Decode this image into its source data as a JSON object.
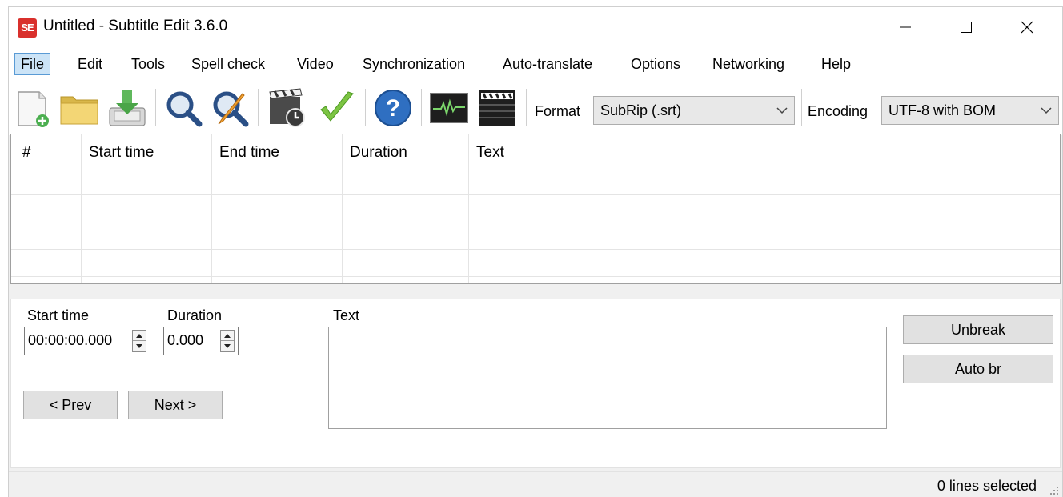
{
  "window": {
    "app_icon_text": "SE",
    "title": "Untitled - Subtitle Edit 3.6.0"
  },
  "menu": {
    "items": [
      {
        "label": "File",
        "mnemonic": "F",
        "rest": "ile",
        "active": true
      },
      {
        "label": "Edit"
      },
      {
        "label": "Tools"
      },
      {
        "label": "Spell check"
      },
      {
        "label": "Video"
      },
      {
        "label": "Synchronization"
      },
      {
        "label": "Auto-translate"
      },
      {
        "label": "Options"
      },
      {
        "label": "Networking"
      },
      {
        "label": "Help"
      }
    ]
  },
  "toolbar": {
    "icons": [
      "new-file-icon",
      "open-folder-icon",
      "save-download-icon",
      "find-icon",
      "replace-icon",
      "visual-sync-icon",
      "spell-check-icon",
      "help-icon",
      "waveform-icon",
      "video-clapper-icon"
    ],
    "format_label": "Format",
    "format_value": "SubRip (.srt)",
    "encoding_label": "Encoding",
    "encoding_value": "UTF-8 with BOM"
  },
  "grid": {
    "columns": [
      "#",
      "Start time",
      "End time",
      "Duration",
      "Text"
    ],
    "rows": []
  },
  "edit": {
    "start_time_label": "Start time",
    "start_time_value": "00:00:00.000",
    "duration_label": "Duration",
    "duration_value": "0.000",
    "text_label": "Text",
    "text_value": "",
    "prev_label": "< Prev",
    "next_label": "Next >",
    "unbreak_label": "Unbreak",
    "auto_br_prefix": "Auto ",
    "auto_br_mnemonic": "br"
  },
  "status": {
    "text": "0 lines selected"
  }
}
